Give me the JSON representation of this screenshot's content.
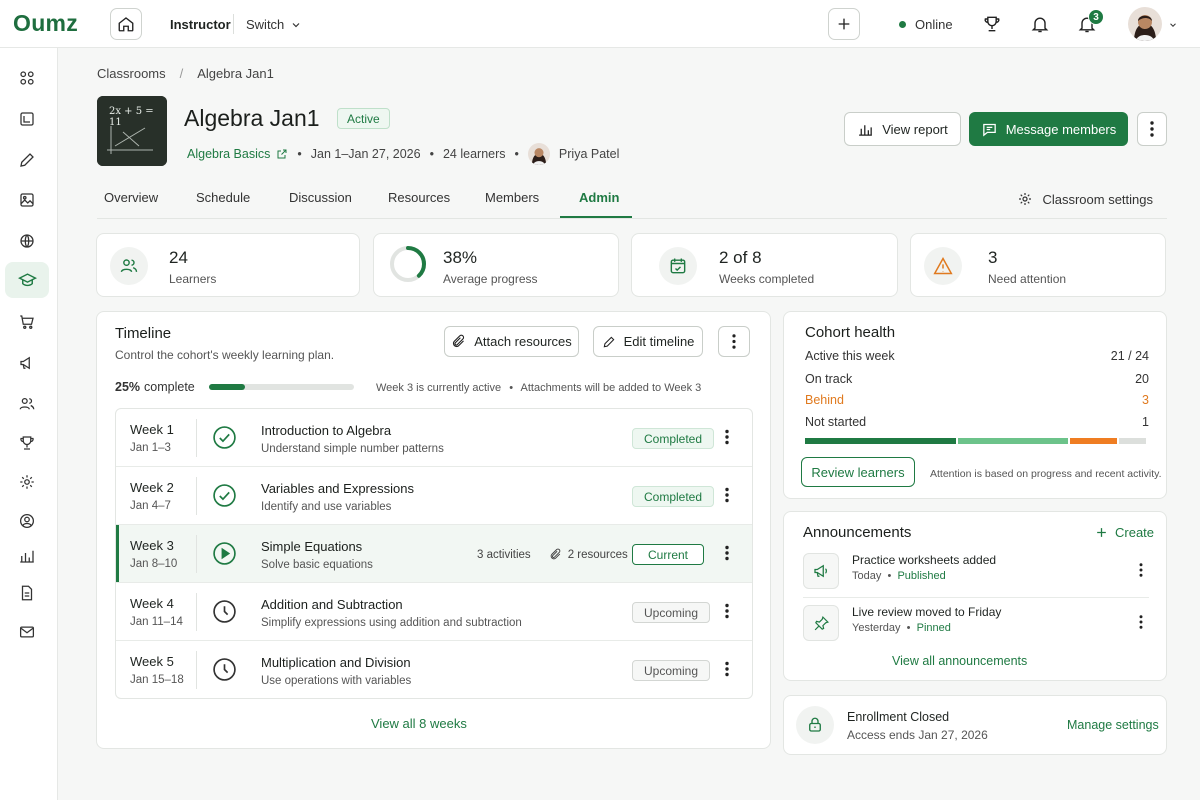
{
  "app": {
    "logo": "Oumz",
    "role": "Instructor",
    "switch_label": "Switch",
    "online_label": "Online",
    "notification_count": "3"
  },
  "breadcrumb": {
    "root": "Classrooms",
    "sep": "/",
    "current": "Algebra Jan1"
  },
  "classroom": {
    "title": "Algebra Jan1",
    "status": "Active",
    "course": "Algebra Basics",
    "dates": "Jan 1–Jan 27, 2026",
    "learners": "24 learners",
    "instructor": "Priya Patel",
    "thumb_equation": "2x + 5 = 11"
  },
  "actions": {
    "view_report": "View report",
    "message_members": "Message members"
  },
  "tabs": [
    "Overview",
    "Schedule",
    "Discussion",
    "Resources",
    "Members",
    "Admin"
  ],
  "active_tab": "Admin",
  "classroom_settings": "Classroom settings",
  "stats": [
    {
      "value": "24",
      "label": "Learners",
      "icon": "users-icon"
    },
    {
      "value": "38%",
      "label": "Average progress",
      "icon": "progress-ring",
      "progress": 0.38
    },
    {
      "value": "2 of 8",
      "label": "Weeks completed",
      "icon": "calendar-check-icon"
    },
    {
      "value": "3",
      "label": "Need attention",
      "icon": "warning-icon"
    }
  ],
  "timeline": {
    "title": "Timeline",
    "subtitle": "Control the cohort's weekly learning plan.",
    "attach_label": "Attach resources",
    "edit_label": "Edit timeline",
    "progress_percent": "25%",
    "progress_word": "complete",
    "progress": 0.25,
    "note_active": "Week 3 is currently active",
    "note_sep": "•",
    "note_attach": "Attachments will be added to Week 3",
    "weeks": [
      {
        "week": "Week 1",
        "dates": "Jan 1–3",
        "title": "Introduction to Algebra",
        "subtitle": "Understand simple number patterns",
        "status": "Completed",
        "state": "done"
      },
      {
        "week": "Week 2",
        "dates": "Jan 4–7",
        "title": "Variables and Expressions",
        "subtitle": "Identify and use variables",
        "status": "Completed",
        "state": "done"
      },
      {
        "week": "Week 3",
        "dates": "Jan 8–10",
        "title": "Simple Equations",
        "subtitle": "Solve basic equations",
        "status": "Current",
        "state": "current",
        "activities": "3 activities",
        "resources": "2 resources"
      },
      {
        "week": "Week 4",
        "dates": "Jan 11–14",
        "title": "Addition and Subtraction",
        "subtitle": "Simplify expressions using addition and subtraction",
        "status": "Upcoming",
        "state": "upcoming"
      },
      {
        "week": "Week 5",
        "dates": "Jan 15–18",
        "title": "Multiplication and Division",
        "subtitle": "Use operations with variables",
        "status": "Upcoming",
        "state": "upcoming"
      }
    ],
    "view_all": "View all 8 weeks"
  },
  "cohort_health": {
    "title": "Cohort health",
    "rows": [
      {
        "label": "Active this week",
        "value": "21 / 24"
      },
      {
        "label": "On track",
        "value": "20"
      },
      {
        "label": "Behind",
        "value": "3",
        "color": "#e07a1f"
      },
      {
        "label": "Not started",
        "value": "1"
      }
    ],
    "bar_segments": [
      {
        "value": 0.45,
        "color": "#1f7a43"
      },
      {
        "value": 0.33,
        "color": "#6cc38a"
      },
      {
        "value": 0.14,
        "color": "#ef7d22"
      },
      {
        "value": 0.08,
        "color": "#dcdfdc"
      }
    ],
    "review_label": "Review learners",
    "note": "Attention is based on progress and recent activity."
  },
  "announcements": {
    "title": "Announcements",
    "create_label": "Create",
    "items": [
      {
        "title": "Practice worksheets added",
        "when": "Today",
        "state": "Published",
        "icon": "megaphone-icon"
      },
      {
        "title": "Live review moved to Friday",
        "when": "Yesterday",
        "state": "Pinned",
        "icon": "pin-icon"
      }
    ],
    "view_all": "View all announcements"
  },
  "enrollment": {
    "title": "Enrollment Closed",
    "subtitle": "Access ends Jan 27, 2026",
    "action": "Manage settings"
  }
}
